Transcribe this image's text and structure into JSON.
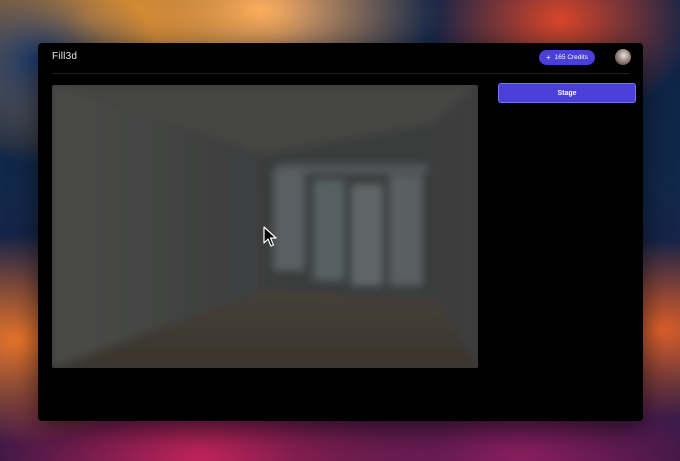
{
  "app": {
    "name": "Fill3d"
  },
  "header": {
    "credits_label": "165 Credits",
    "credits_icon": "plus-icon",
    "avatar_icon": "user-avatar"
  },
  "sidebar": {
    "stage_button_label": "Stage"
  },
  "colors": {
    "accent": "#4a3fd8",
    "window_bg": "#000000"
  },
  "preview": {
    "icon": "room-photo-blurred"
  }
}
